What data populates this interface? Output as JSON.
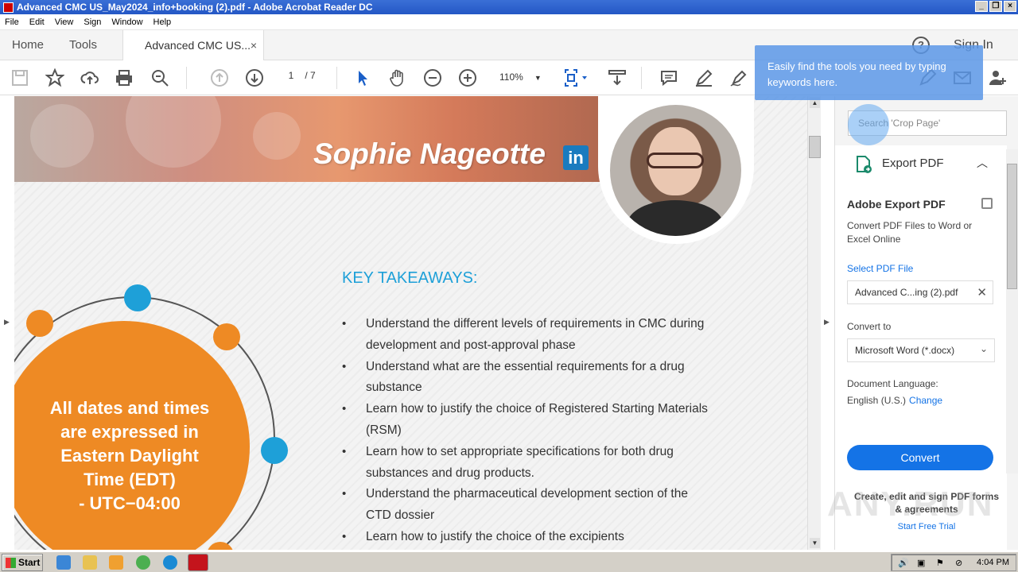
{
  "window": {
    "title": "Advanced CMC US_May2024_info+booking (2).pdf - Adobe Acrobat Reader DC"
  },
  "menu": [
    "File",
    "Edit",
    "View",
    "Sign",
    "Window",
    "Help"
  ],
  "tabs": {
    "home": "Home",
    "tools": "Tools",
    "document": "Advanced CMC US...",
    "close": "×"
  },
  "header": {
    "help": "?",
    "sign_in": "Sign In"
  },
  "toolbar": {
    "page_current": "1",
    "page_total": "/ 7",
    "zoom": "110%"
  },
  "tooltip": {
    "text": "Easily find the tools you need by typing keywords here."
  },
  "document": {
    "speaker_name": "Sophie Nageotte",
    "linkedin": "in",
    "key_title": "KEY TAKEAWAYS:",
    "takeaways": [
      "Understand the different levels of requirements in CMC during development and post-approval phase",
      "Understand what are the essential requirements for a drug substance",
      "Learn how to justify the choice of Registered Starting Materials (RSM)",
      "Learn how to set appropriate specifications for both drug substances and drug products.",
      "Understand the pharmaceutical development section of the CTD dossier",
      "Learn how to justify the choice of the excipients"
    ],
    "dates_line1": "All dates and times",
    "dates_line2": "are expressed in",
    "dates_line3": "Eastern Daylight",
    "dates_line4": "Time (EDT)",
    "dates_line5": "- UTC−04:00"
  },
  "right_pane": {
    "search_placeholder": "Search 'Crop Page'",
    "export_label": "Export PDF",
    "title": "Adobe Export PDF",
    "description": "Convert PDF Files to Word or Excel Online",
    "select_file": "Select PDF File",
    "file_name": "Advanced C...ing (2).pdf",
    "convert_to_label": "Convert to",
    "convert_to_value": "Microsoft Word (*.docx)",
    "doc_lang_label": "Document Language:",
    "doc_lang_value": "English (U.S.)",
    "change": "Change",
    "convert_button": "Convert",
    "promo": "Create, edit and sign PDF forms & agreements",
    "trial": "Start Free Trial"
  },
  "watermark": "ANY.RUN",
  "taskbar": {
    "start": "Start",
    "clock": "4:04 PM"
  },
  "colors": {
    "accent_blue": "#1473e6",
    "orange": "#ee8a24",
    "cyan": "#1ea0d8"
  }
}
